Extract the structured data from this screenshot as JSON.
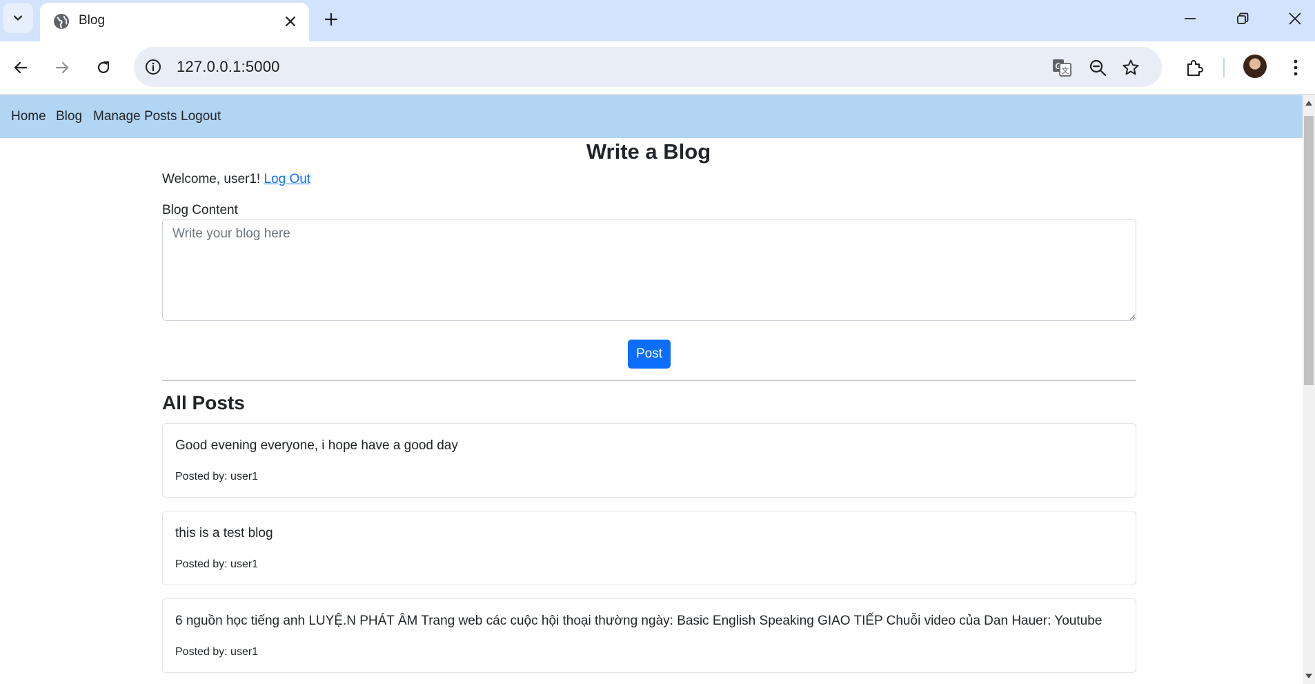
{
  "browser": {
    "tab_title": "Blog",
    "url": "127.0.0.1:5000",
    "icons": [
      "tab-list-icon",
      "globe-icon",
      "close-icon",
      "plus-icon",
      "minimize-icon",
      "restore-icon",
      "window-close-icon",
      "back-icon",
      "forward-icon",
      "reload-icon",
      "info-icon",
      "translate-icon",
      "zoom-out-icon",
      "star-icon",
      "extensions-icon",
      "avatar",
      "more-icon"
    ]
  },
  "nav": {
    "items": [
      {
        "label": "Home"
      },
      {
        "label": "Blog"
      },
      {
        "label": "Manage Posts"
      },
      {
        "label": "Logout"
      }
    ]
  },
  "main": {
    "title": "Write a Blog",
    "welcome_text": "Welcome, user1! ",
    "logout_link": "Log Out",
    "content_label": "Blog Content",
    "textarea_placeholder": "Write your blog here",
    "textarea_value": "",
    "post_button": "Post",
    "section_title": "All Posts"
  },
  "posts": [
    {
      "content": "Good evening everyone, i hope have a good day",
      "meta": "Posted by: user1"
    },
    {
      "content": "this is a test blog",
      "meta": "Posted by: user1"
    },
    {
      "content": "6 nguồn học tiếng anh LUYỆ.N PHÁT ÂM Trang web các cuộc hội thoại thường ngày: Basic English Speaking GIAO TIẾP Chuỗi video của Dan Hauer: Youtube",
      "meta": "Posted by: user1"
    }
  ],
  "colors": {
    "nav_bg": "#b1d5f2",
    "primary": "#0d6efd",
    "chrome_bg": "#d3e3fd",
    "omnibox_bg": "#e9eef6"
  }
}
